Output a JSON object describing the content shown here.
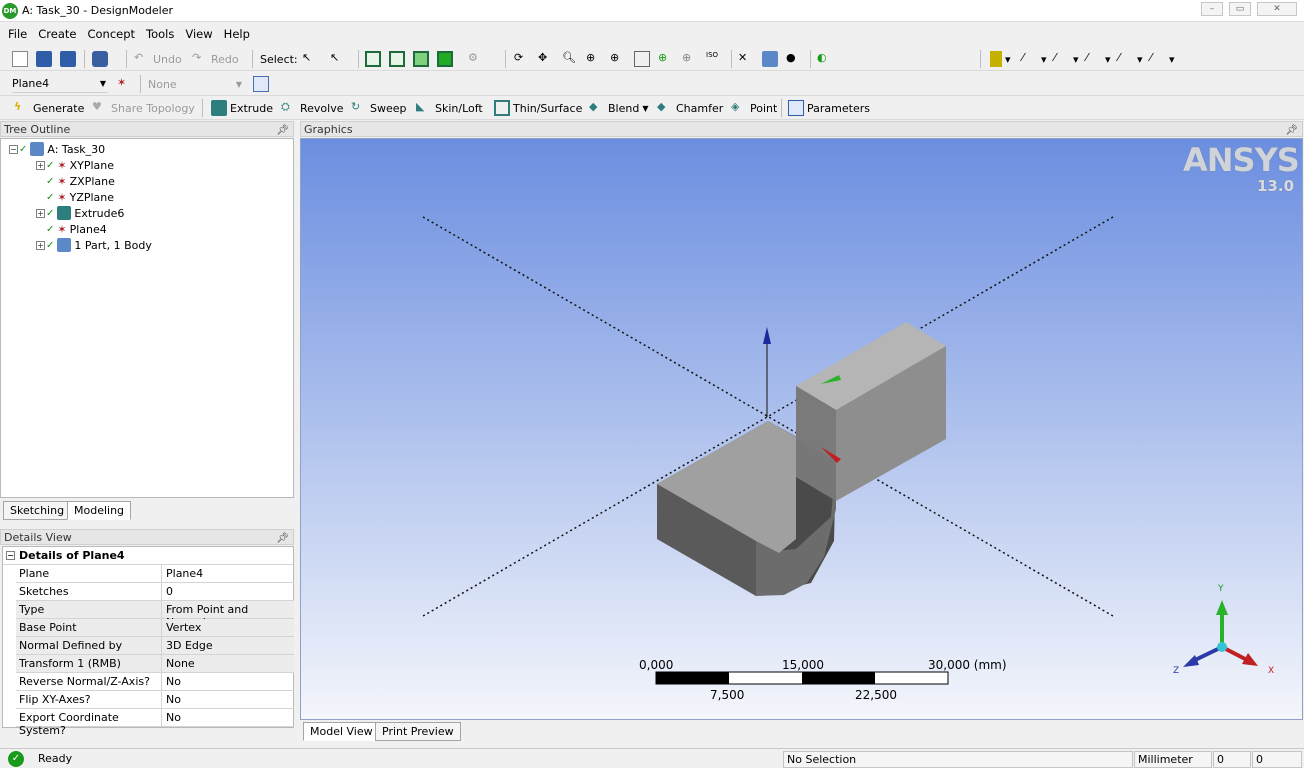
{
  "window": {
    "title": "A: Task_30 - DesignModeler",
    "icon_label": "DM"
  },
  "menu": [
    "File",
    "Create",
    "Concept",
    "Tools",
    "View",
    "Help"
  ],
  "toolbar1": {
    "undo": "Undo",
    "redo": "Redo",
    "select_label": "Select:"
  },
  "toolbar2": {
    "plane_value": "Plane4",
    "sketch_value": "None"
  },
  "toolbar3": {
    "generate": "Generate",
    "share_topology": "Share Topology",
    "extrude": "Extrude",
    "revolve": "Revolve",
    "sweep": "Sweep",
    "skin_loft": "Skin/Loft",
    "thin_surface": "Thin/Surface",
    "blend": "Blend",
    "chamfer": "Chamfer",
    "point": "Point",
    "parameters": "Parameters"
  },
  "tree_outline": {
    "title": "Tree Outline",
    "root": "A: Task_30",
    "items": [
      {
        "label": "XYPlane",
        "expandable": true
      },
      {
        "label": "ZXPlane",
        "expandable": false
      },
      {
        "label": "YZPlane",
        "expandable": false
      },
      {
        "label": "Extrude6",
        "expandable": true
      },
      {
        "label": "Plane4",
        "expandable": false
      },
      {
        "label": "1 Part, 1 Body",
        "expandable": true
      }
    ]
  },
  "left_tabs": [
    "Sketching",
    "Modeling"
  ],
  "details": {
    "panel_title": "Details View",
    "section": "Details of Plane4",
    "rows": [
      {
        "key": "Plane",
        "value": "Plane4"
      },
      {
        "key": "Sketches",
        "value": "0"
      },
      {
        "key": "Type",
        "value": "From Point and Normal"
      },
      {
        "key": "Base Point",
        "value": "Vertex"
      },
      {
        "key": "Normal Defined by",
        "value": "3D Edge"
      },
      {
        "key": "Transform 1 (RMB)",
        "value": "None"
      },
      {
        "key": "Reverse Normal/Z-Axis?",
        "value": "No"
      },
      {
        "key": "Flip XY-Axes?",
        "value": "No"
      },
      {
        "key": "Export Coordinate System?",
        "value": "No"
      }
    ]
  },
  "graphics": {
    "title": "Graphics",
    "logo": "ANSYS",
    "version": "13.0",
    "tabs": [
      "Model View",
      "Print Preview"
    ],
    "scale": {
      "top_labels": [
        "0,000",
        "15,000",
        "30,000 (mm)"
      ],
      "bottom_labels": [
        "7,500",
        "22,500"
      ]
    },
    "triad": {
      "x": "X",
      "y": "Y",
      "z": "Z"
    }
  },
  "status": {
    "text": "Ready",
    "selection": "No Selection",
    "units": "Millimeter",
    "field1": "0",
    "field2": "0"
  },
  "colors": {
    "accent_green": "#1a9a1a",
    "graphics_top": "#6b8ee0",
    "graphics_bottom": "#f4f6fb"
  }
}
